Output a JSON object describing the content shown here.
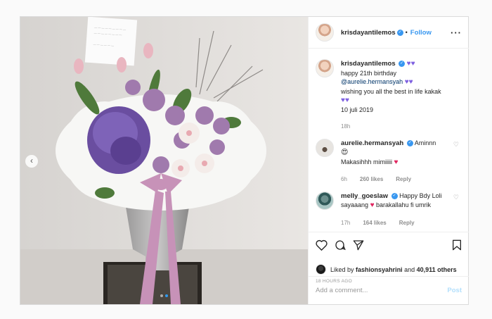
{
  "post": {
    "author": "krisdayantilemos",
    "follow_label": "Follow",
    "more_icon": "more-options-icon",
    "verified_mark": "✓",
    "caption": {
      "line1": "happy 21th birthday",
      "mention": "@aurelie.hermansyah",
      "line3": "wishing you all the best in life kakak",
      "date": "10 juli 2019",
      "time": "18h"
    },
    "comments": [
      {
        "user": "aurelie.hermansyah",
        "text_a": "Aminnn",
        "text_b": "Makasihhh mimiiiii",
        "time": "6h",
        "likes": "260 likes",
        "reply": "Reply"
      },
      {
        "user": "melly_goeslaw",
        "text_a": "Happy Bdy Loli sayaaang",
        "text_b": "barakallahu fi umrik",
        "time": "17h",
        "likes": "164 likes",
        "reply": "Reply"
      }
    ],
    "liked_by": {
      "prefix": "Liked by",
      "user": "fashionsyahrini",
      "conj": "and",
      "others": "40,911 others"
    },
    "timestamp": "18 HOURS AGO",
    "comment_input": {
      "placeholder": "Add a comment...",
      "post_label": "Post"
    },
    "colors": {
      "accent": "#3897f0",
      "heart_purple": "#7d5fe0",
      "heart_red": "#e0245e"
    }
  },
  "carousel": {
    "prev_glyph": "‹"
  }
}
